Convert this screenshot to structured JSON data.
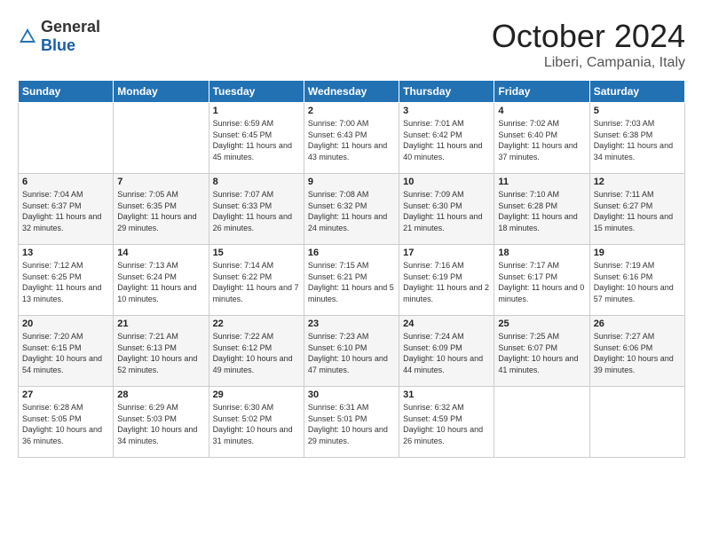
{
  "header": {
    "logo": {
      "general": "General",
      "blue": "Blue"
    },
    "title": "October 2024",
    "location": "Liberi, Campania, Italy"
  },
  "calendar": {
    "days_of_week": [
      "Sunday",
      "Monday",
      "Tuesday",
      "Wednesday",
      "Thursday",
      "Friday",
      "Saturday"
    ],
    "weeks": [
      [
        {
          "day": "",
          "sunrise": "",
          "sunset": "",
          "daylight": ""
        },
        {
          "day": "",
          "sunrise": "",
          "sunset": "",
          "daylight": ""
        },
        {
          "day": "1",
          "sunrise": "Sunrise: 6:59 AM",
          "sunset": "Sunset: 6:45 PM",
          "daylight": "Daylight: 11 hours and 45 minutes."
        },
        {
          "day": "2",
          "sunrise": "Sunrise: 7:00 AM",
          "sunset": "Sunset: 6:43 PM",
          "daylight": "Daylight: 11 hours and 43 minutes."
        },
        {
          "day": "3",
          "sunrise": "Sunrise: 7:01 AM",
          "sunset": "Sunset: 6:42 PM",
          "daylight": "Daylight: 11 hours and 40 minutes."
        },
        {
          "day": "4",
          "sunrise": "Sunrise: 7:02 AM",
          "sunset": "Sunset: 6:40 PM",
          "daylight": "Daylight: 11 hours and 37 minutes."
        },
        {
          "day": "5",
          "sunrise": "Sunrise: 7:03 AM",
          "sunset": "Sunset: 6:38 PM",
          "daylight": "Daylight: 11 hours and 34 minutes."
        }
      ],
      [
        {
          "day": "6",
          "sunrise": "Sunrise: 7:04 AM",
          "sunset": "Sunset: 6:37 PM",
          "daylight": "Daylight: 11 hours and 32 minutes."
        },
        {
          "day": "7",
          "sunrise": "Sunrise: 7:05 AM",
          "sunset": "Sunset: 6:35 PM",
          "daylight": "Daylight: 11 hours and 29 minutes."
        },
        {
          "day": "8",
          "sunrise": "Sunrise: 7:07 AM",
          "sunset": "Sunset: 6:33 PM",
          "daylight": "Daylight: 11 hours and 26 minutes."
        },
        {
          "day": "9",
          "sunrise": "Sunrise: 7:08 AM",
          "sunset": "Sunset: 6:32 PM",
          "daylight": "Daylight: 11 hours and 24 minutes."
        },
        {
          "day": "10",
          "sunrise": "Sunrise: 7:09 AM",
          "sunset": "Sunset: 6:30 PM",
          "daylight": "Daylight: 11 hours and 21 minutes."
        },
        {
          "day": "11",
          "sunrise": "Sunrise: 7:10 AM",
          "sunset": "Sunset: 6:28 PM",
          "daylight": "Daylight: 11 hours and 18 minutes."
        },
        {
          "day": "12",
          "sunrise": "Sunrise: 7:11 AM",
          "sunset": "Sunset: 6:27 PM",
          "daylight": "Daylight: 11 hours and 15 minutes."
        }
      ],
      [
        {
          "day": "13",
          "sunrise": "Sunrise: 7:12 AM",
          "sunset": "Sunset: 6:25 PM",
          "daylight": "Daylight: 11 hours and 13 minutes."
        },
        {
          "day": "14",
          "sunrise": "Sunrise: 7:13 AM",
          "sunset": "Sunset: 6:24 PM",
          "daylight": "Daylight: 11 hours and 10 minutes."
        },
        {
          "day": "15",
          "sunrise": "Sunrise: 7:14 AM",
          "sunset": "Sunset: 6:22 PM",
          "daylight": "Daylight: 11 hours and 7 minutes."
        },
        {
          "day": "16",
          "sunrise": "Sunrise: 7:15 AM",
          "sunset": "Sunset: 6:21 PM",
          "daylight": "Daylight: 11 hours and 5 minutes."
        },
        {
          "day": "17",
          "sunrise": "Sunrise: 7:16 AM",
          "sunset": "Sunset: 6:19 PM",
          "daylight": "Daylight: 11 hours and 2 minutes."
        },
        {
          "day": "18",
          "sunrise": "Sunrise: 7:17 AM",
          "sunset": "Sunset: 6:17 PM",
          "daylight": "Daylight: 11 hours and 0 minutes."
        },
        {
          "day": "19",
          "sunrise": "Sunrise: 7:19 AM",
          "sunset": "Sunset: 6:16 PM",
          "daylight": "Daylight: 10 hours and 57 minutes."
        }
      ],
      [
        {
          "day": "20",
          "sunrise": "Sunrise: 7:20 AM",
          "sunset": "Sunset: 6:15 PM",
          "daylight": "Daylight: 10 hours and 54 minutes."
        },
        {
          "day": "21",
          "sunrise": "Sunrise: 7:21 AM",
          "sunset": "Sunset: 6:13 PM",
          "daylight": "Daylight: 10 hours and 52 minutes."
        },
        {
          "day": "22",
          "sunrise": "Sunrise: 7:22 AM",
          "sunset": "Sunset: 6:12 PM",
          "daylight": "Daylight: 10 hours and 49 minutes."
        },
        {
          "day": "23",
          "sunrise": "Sunrise: 7:23 AM",
          "sunset": "Sunset: 6:10 PM",
          "daylight": "Daylight: 10 hours and 47 minutes."
        },
        {
          "day": "24",
          "sunrise": "Sunrise: 7:24 AM",
          "sunset": "Sunset: 6:09 PM",
          "daylight": "Daylight: 10 hours and 44 minutes."
        },
        {
          "day": "25",
          "sunrise": "Sunrise: 7:25 AM",
          "sunset": "Sunset: 6:07 PM",
          "daylight": "Daylight: 10 hours and 41 minutes."
        },
        {
          "day": "26",
          "sunrise": "Sunrise: 7:27 AM",
          "sunset": "Sunset: 6:06 PM",
          "daylight": "Daylight: 10 hours and 39 minutes."
        }
      ],
      [
        {
          "day": "27",
          "sunrise": "Sunrise: 6:28 AM",
          "sunset": "Sunset: 5:05 PM",
          "daylight": "Daylight: 10 hours and 36 minutes."
        },
        {
          "day": "28",
          "sunrise": "Sunrise: 6:29 AM",
          "sunset": "Sunset: 5:03 PM",
          "daylight": "Daylight: 10 hours and 34 minutes."
        },
        {
          "day": "29",
          "sunrise": "Sunrise: 6:30 AM",
          "sunset": "Sunset: 5:02 PM",
          "daylight": "Daylight: 10 hours and 31 minutes."
        },
        {
          "day": "30",
          "sunrise": "Sunrise: 6:31 AM",
          "sunset": "Sunset: 5:01 PM",
          "daylight": "Daylight: 10 hours and 29 minutes."
        },
        {
          "day": "31",
          "sunrise": "Sunrise: 6:32 AM",
          "sunset": "Sunset: 4:59 PM",
          "daylight": "Daylight: 10 hours and 26 minutes."
        },
        {
          "day": "",
          "sunrise": "",
          "sunset": "",
          "daylight": ""
        },
        {
          "day": "",
          "sunrise": "",
          "sunset": "",
          "daylight": ""
        }
      ]
    ]
  }
}
